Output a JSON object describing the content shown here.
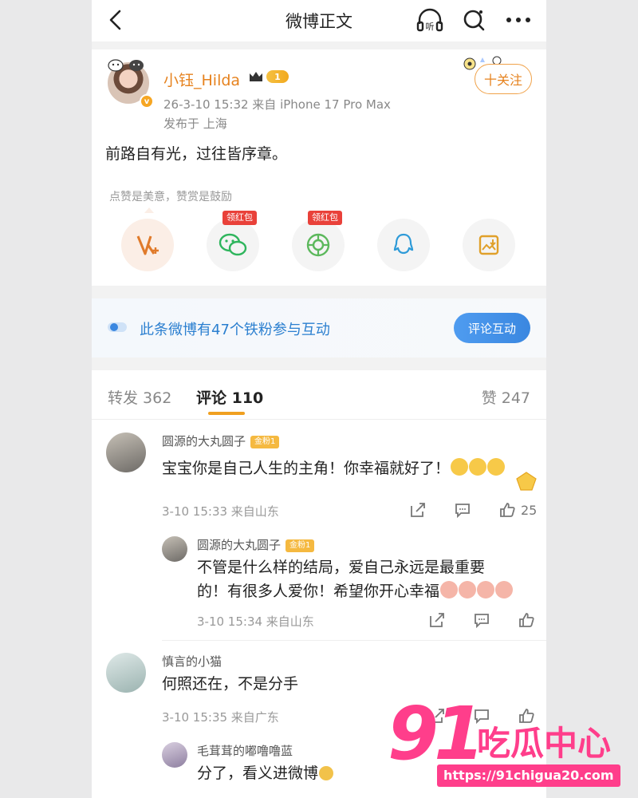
{
  "nav": {
    "title": "微博正文"
  },
  "post": {
    "username": "小钰_Hilda",
    "level": "1",
    "meta": "26-3-10 15:32  来自 iPhone 17 Pro Max",
    "location": "发布于 上海",
    "follow_label": "十关注",
    "text": "前路自有光，过往皆序章。",
    "tip": "点赞是美意，赞赏是鼓励",
    "share": [
      {
        "icon": "reward-v-icon",
        "badge": ""
      },
      {
        "icon": "wechat-icon",
        "badge": "领红包"
      },
      {
        "icon": "moments-icon",
        "badge": "领红包"
      },
      {
        "icon": "qq-icon",
        "badge": ""
      },
      {
        "icon": "save-image-icon",
        "badge": ""
      }
    ]
  },
  "fans": {
    "text": "此条微博有47个铁粉参与互动",
    "button": "评论互动"
  },
  "tabs": {
    "repost": "转发 362",
    "comment": "评论 110",
    "like": "赞 247"
  },
  "comments": [
    {
      "name": "圆源的大丸圆子",
      "badge": "金粉1",
      "text": "宝宝你是自己人生的主角！你幸福就好了！",
      "meta": "3-10 15:33  来自山东",
      "likes": "25",
      "reply": {
        "name": "圆源的大丸圆子",
        "badge": "金粉1",
        "text_line1": "不管是什么样的结局，爱自己永远是最重要",
        "text_line2": "的！有很多人爱你！希望你开心幸福",
        "meta": "3-10 15:34  来自山东"
      }
    },
    {
      "name": "慎言的小猫",
      "text": "何照还在，不是分手",
      "meta": "3-10 15:35  来自广东",
      "reply": {
        "name": "毛茸茸的嘟噜噜蓝",
        "text": "分了，看义进微博"
      }
    }
  ],
  "watermark": {
    "num": "91",
    "brand": "吃瓜中心",
    "url": "https://91chigua20.com"
  },
  "colors": {
    "accent": "#e6821e",
    "link": "#2b7fd0",
    "watermark": "#ff3e8b"
  }
}
